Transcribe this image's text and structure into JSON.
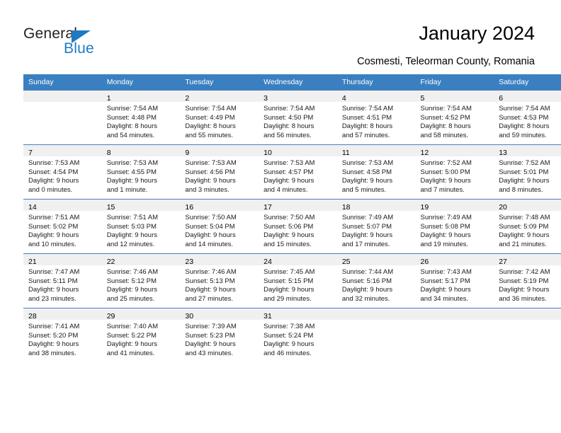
{
  "brand": {
    "name_part1": "General",
    "name_part2": "Blue",
    "accent_color": "#1f7ac4",
    "triangle_icon": "triangle-icon"
  },
  "header": {
    "title": "January 2024",
    "subtitle": "Cosmesti, Teleorman County, Romania"
  },
  "calendar": {
    "header_bg": "#3a80c1",
    "header_text_color": "#ffffff",
    "weekday_headers": [
      "Sunday",
      "Monday",
      "Tuesday",
      "Wednesday",
      "Thursday",
      "Friday",
      "Saturday"
    ],
    "weeks": [
      [
        {
          "day": "",
          "sunrise": "",
          "sunset": "",
          "daylight_line1": "",
          "daylight_line2": "",
          "empty": true
        },
        {
          "day": "1",
          "sunrise": "Sunrise: 7:54 AM",
          "sunset": "Sunset: 4:48 PM",
          "daylight_line1": "Daylight: 8 hours",
          "daylight_line2": "and 54 minutes."
        },
        {
          "day": "2",
          "sunrise": "Sunrise: 7:54 AM",
          "sunset": "Sunset: 4:49 PM",
          "daylight_line1": "Daylight: 8 hours",
          "daylight_line2": "and 55 minutes."
        },
        {
          "day": "3",
          "sunrise": "Sunrise: 7:54 AM",
          "sunset": "Sunset: 4:50 PM",
          "daylight_line1": "Daylight: 8 hours",
          "daylight_line2": "and 56 minutes."
        },
        {
          "day": "4",
          "sunrise": "Sunrise: 7:54 AM",
          "sunset": "Sunset: 4:51 PM",
          "daylight_line1": "Daylight: 8 hours",
          "daylight_line2": "and 57 minutes."
        },
        {
          "day": "5",
          "sunrise": "Sunrise: 7:54 AM",
          "sunset": "Sunset: 4:52 PM",
          "daylight_line1": "Daylight: 8 hours",
          "daylight_line2": "and 58 minutes."
        },
        {
          "day": "6",
          "sunrise": "Sunrise: 7:54 AM",
          "sunset": "Sunset: 4:53 PM",
          "daylight_line1": "Daylight: 8 hours",
          "daylight_line2": "and 59 minutes."
        }
      ],
      [
        {
          "day": "7",
          "sunrise": "Sunrise: 7:53 AM",
          "sunset": "Sunset: 4:54 PM",
          "daylight_line1": "Daylight: 9 hours",
          "daylight_line2": "and 0 minutes."
        },
        {
          "day": "8",
          "sunrise": "Sunrise: 7:53 AM",
          "sunset": "Sunset: 4:55 PM",
          "daylight_line1": "Daylight: 9 hours",
          "daylight_line2": "and 1 minute."
        },
        {
          "day": "9",
          "sunrise": "Sunrise: 7:53 AM",
          "sunset": "Sunset: 4:56 PM",
          "daylight_line1": "Daylight: 9 hours",
          "daylight_line2": "and 3 minutes."
        },
        {
          "day": "10",
          "sunrise": "Sunrise: 7:53 AM",
          "sunset": "Sunset: 4:57 PM",
          "daylight_line1": "Daylight: 9 hours",
          "daylight_line2": "and 4 minutes."
        },
        {
          "day": "11",
          "sunrise": "Sunrise: 7:53 AM",
          "sunset": "Sunset: 4:58 PM",
          "daylight_line1": "Daylight: 9 hours",
          "daylight_line2": "and 5 minutes."
        },
        {
          "day": "12",
          "sunrise": "Sunrise: 7:52 AM",
          "sunset": "Sunset: 5:00 PM",
          "daylight_line1": "Daylight: 9 hours",
          "daylight_line2": "and 7 minutes."
        },
        {
          "day": "13",
          "sunrise": "Sunrise: 7:52 AM",
          "sunset": "Sunset: 5:01 PM",
          "daylight_line1": "Daylight: 9 hours",
          "daylight_line2": "and 8 minutes."
        }
      ],
      [
        {
          "day": "14",
          "sunrise": "Sunrise: 7:51 AM",
          "sunset": "Sunset: 5:02 PM",
          "daylight_line1": "Daylight: 9 hours",
          "daylight_line2": "and 10 minutes."
        },
        {
          "day": "15",
          "sunrise": "Sunrise: 7:51 AM",
          "sunset": "Sunset: 5:03 PM",
          "daylight_line1": "Daylight: 9 hours",
          "daylight_line2": "and 12 minutes."
        },
        {
          "day": "16",
          "sunrise": "Sunrise: 7:50 AM",
          "sunset": "Sunset: 5:04 PM",
          "daylight_line1": "Daylight: 9 hours",
          "daylight_line2": "and 14 minutes."
        },
        {
          "day": "17",
          "sunrise": "Sunrise: 7:50 AM",
          "sunset": "Sunset: 5:06 PM",
          "daylight_line1": "Daylight: 9 hours",
          "daylight_line2": "and 15 minutes."
        },
        {
          "day": "18",
          "sunrise": "Sunrise: 7:49 AM",
          "sunset": "Sunset: 5:07 PM",
          "daylight_line1": "Daylight: 9 hours",
          "daylight_line2": "and 17 minutes."
        },
        {
          "day": "19",
          "sunrise": "Sunrise: 7:49 AM",
          "sunset": "Sunset: 5:08 PM",
          "daylight_line1": "Daylight: 9 hours",
          "daylight_line2": "and 19 minutes."
        },
        {
          "day": "20",
          "sunrise": "Sunrise: 7:48 AM",
          "sunset": "Sunset: 5:09 PM",
          "daylight_line1": "Daylight: 9 hours",
          "daylight_line2": "and 21 minutes."
        }
      ],
      [
        {
          "day": "21",
          "sunrise": "Sunrise: 7:47 AM",
          "sunset": "Sunset: 5:11 PM",
          "daylight_line1": "Daylight: 9 hours",
          "daylight_line2": "and 23 minutes."
        },
        {
          "day": "22",
          "sunrise": "Sunrise: 7:46 AM",
          "sunset": "Sunset: 5:12 PM",
          "daylight_line1": "Daylight: 9 hours",
          "daylight_line2": "and 25 minutes."
        },
        {
          "day": "23",
          "sunrise": "Sunrise: 7:46 AM",
          "sunset": "Sunset: 5:13 PM",
          "daylight_line1": "Daylight: 9 hours",
          "daylight_line2": "and 27 minutes."
        },
        {
          "day": "24",
          "sunrise": "Sunrise: 7:45 AM",
          "sunset": "Sunset: 5:15 PM",
          "daylight_line1": "Daylight: 9 hours",
          "daylight_line2": "and 29 minutes."
        },
        {
          "day": "25",
          "sunrise": "Sunrise: 7:44 AM",
          "sunset": "Sunset: 5:16 PM",
          "daylight_line1": "Daylight: 9 hours",
          "daylight_line2": "and 32 minutes."
        },
        {
          "day": "26",
          "sunrise": "Sunrise: 7:43 AM",
          "sunset": "Sunset: 5:17 PM",
          "daylight_line1": "Daylight: 9 hours",
          "daylight_line2": "and 34 minutes."
        },
        {
          "day": "27",
          "sunrise": "Sunrise: 7:42 AM",
          "sunset": "Sunset: 5:19 PM",
          "daylight_line1": "Daylight: 9 hours",
          "daylight_line2": "and 36 minutes."
        }
      ],
      [
        {
          "day": "28",
          "sunrise": "Sunrise: 7:41 AM",
          "sunset": "Sunset: 5:20 PM",
          "daylight_line1": "Daylight: 9 hours",
          "daylight_line2": "and 38 minutes."
        },
        {
          "day": "29",
          "sunrise": "Sunrise: 7:40 AM",
          "sunset": "Sunset: 5:22 PM",
          "daylight_line1": "Daylight: 9 hours",
          "daylight_line2": "and 41 minutes."
        },
        {
          "day": "30",
          "sunrise": "Sunrise: 7:39 AM",
          "sunset": "Sunset: 5:23 PM",
          "daylight_line1": "Daylight: 9 hours",
          "daylight_line2": "and 43 minutes."
        },
        {
          "day": "31",
          "sunrise": "Sunrise: 7:38 AM",
          "sunset": "Sunset: 5:24 PM",
          "daylight_line1": "Daylight: 9 hours",
          "daylight_line2": "and 46 minutes."
        },
        {
          "day": "",
          "sunrise": "",
          "sunset": "",
          "daylight_line1": "",
          "daylight_line2": "",
          "empty": true
        },
        {
          "day": "",
          "sunrise": "",
          "sunset": "",
          "daylight_line1": "",
          "daylight_line2": "",
          "empty": true
        },
        {
          "day": "",
          "sunrise": "",
          "sunset": "",
          "daylight_line1": "",
          "daylight_line2": "",
          "empty": true
        }
      ]
    ]
  }
}
